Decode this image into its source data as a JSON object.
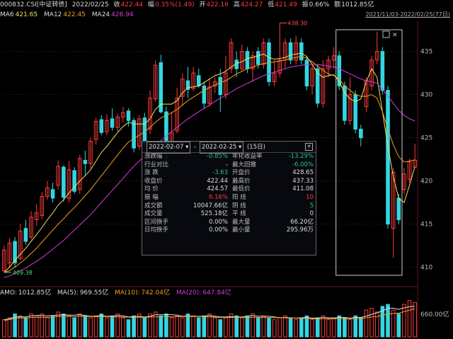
{
  "header": {
    "code": "000832.CSI[中证转债]",
    "date": "2022/02/25",
    "close_label": "收",
    "close": "422.44",
    "change_label": "幅",
    "change": "0.35%(1.49)",
    "open_label": "开",
    "open": "422.16",
    "high_label": "高",
    "high": "424.27",
    "low_label": "低",
    "low": "421.49",
    "amp_label": "振",
    "amp": "0.66%",
    "amount_label": "额",
    "amount": "1012.85亿",
    "ma6": "MA6",
    "ma6_val": "421.65",
    "ma12": "MA12",
    "ma12_val": "422.45",
    "ma24": "MA24",
    "ma24_val": "426.94",
    "range": "2021/11/03-2022/02/25(77日)"
  },
  "colors": {
    "up": "#ff3b3b",
    "down": "#33d6e0",
    "ma6": "#f0e060",
    "ma12": "#f0a020",
    "ma24": "#d03ed8",
    "selection": "#cccccc"
  },
  "annotations": {
    "max_label": "438.30",
    "min_label": "409.38"
  },
  "amo": {
    "label": "AMO:",
    "value": "1012.85亿",
    "ma5": "MA(5):",
    "ma5_val": "969.55亿",
    "ma10": "MA(10):",
    "ma10_val": "742.04亿",
    "ma20": "MA(20):",
    "ma20_val": "647.84亿",
    "axis_label": "660.00亿"
  },
  "info_panel": {
    "start": "2022-02-07",
    "sep": "-",
    "end": "2022-02-25",
    "days": "(15日)",
    "rows": [
      [
        "涨跌幅",
        "-0.85%",
        "年化收益率",
        "-13.29%"
      ],
      [
        "行业对比",
        "-",
        "最大回撤",
        "-6.00%"
      ],
      [
        "涨  跌",
        "-3.63",
        "开盘价",
        "428.65"
      ],
      [
        "收盘价",
        "422.44",
        "最高价",
        "437.33"
      ],
      [
        "均  价",
        "424.57",
        "最低价",
        "411.08"
      ],
      [
        "振  幅",
        "6.16%",
        "阳  线",
        "10"
      ],
      [
        "成交额",
        "10047.66亿",
        "阴  线",
        "5"
      ],
      [
        "成交量",
        "525.18亿",
        "平  线",
        "0"
      ],
      [
        "区间换手",
        "0.00%",
        "最大量",
        "66.20亿"
      ],
      [
        "日均换手",
        "0.00%",
        "最小量",
        "295.96万"
      ]
    ]
  },
  "chart_data": {
    "type": "candlestick",
    "title": "000832.CSI[中证转债]",
    "y_ticks": [
      410,
      415,
      420,
      425,
      430,
      435
    ],
    "ylim": [
      408,
      438.5
    ],
    "candles": [
      {
        "o": 409.6,
        "c": 412.0,
        "h": 412.5,
        "l": 409.4
      },
      {
        "o": 410.5,
        "c": 412.8,
        "h": 413.4,
        "l": 410.0
      },
      {
        "o": 413.0,
        "c": 410.5,
        "h": 413.5,
        "l": 410.0
      },
      {
        "o": 411.0,
        "c": 414.2,
        "h": 415.0,
        "l": 410.8
      },
      {
        "o": 414.5,
        "c": 413.0,
        "h": 415.5,
        "l": 412.6
      },
      {
        "o": 413.5,
        "c": 415.8,
        "h": 416.5,
        "l": 413.2
      },
      {
        "o": 415.5,
        "c": 416.3,
        "h": 417.3,
        "l": 414.8
      },
      {
        "o": 416.0,
        "c": 418.2,
        "h": 418.7,
        "l": 415.6
      },
      {
        "o": 418.2,
        "c": 419.2,
        "h": 420.0,
        "l": 417.8
      },
      {
        "o": 419.0,
        "c": 418.0,
        "h": 419.8,
        "l": 417.5
      },
      {
        "o": 419.5,
        "c": 421.7,
        "h": 422.4,
        "l": 419.0
      },
      {
        "o": 421.6,
        "c": 418.1,
        "h": 421.8,
        "l": 417.6
      },
      {
        "o": 418.0,
        "c": 421.3,
        "h": 422.3,
        "l": 417.5
      },
      {
        "o": 421.2,
        "c": 418.8,
        "h": 421.6,
        "l": 418.5
      },
      {
        "o": 419.0,
        "c": 422.6,
        "h": 423.0,
        "l": 418.5
      },
      {
        "o": 422.4,
        "c": 422.0,
        "h": 423.5,
        "l": 420.6
      },
      {
        "o": 422.0,
        "c": 424.6,
        "h": 425.0,
        "l": 421.5
      },
      {
        "o": 424.8,
        "c": 426.9,
        "h": 427.3,
        "l": 424.2
      },
      {
        "o": 427.1,
        "c": 425.6,
        "h": 427.6,
        "l": 425.3
      },
      {
        "o": 425.7,
        "c": 427.0,
        "h": 427.7,
        "l": 425.3
      },
      {
        "o": 427.2,
        "c": 426.2,
        "h": 428.4,
        "l": 425.8
      },
      {
        "o": 426.2,
        "c": 427.4,
        "h": 427.8,
        "l": 425.7
      },
      {
        "o": 427.4,
        "c": 427.9,
        "h": 428.6,
        "l": 426.8
      },
      {
        "o": 428.1,
        "c": 427.0,
        "h": 428.4,
        "l": 426.3
      },
      {
        "o": 427.0,
        "c": 423.8,
        "h": 427.3,
        "l": 423.3
      },
      {
        "o": 424.0,
        "c": 427.2,
        "h": 427.6,
        "l": 423.6
      },
      {
        "o": 427.3,
        "c": 424.5,
        "h": 427.9,
        "l": 424.0
      },
      {
        "o": 426.0,
        "c": 429.6,
        "h": 430.5,
        "l": 425.4
      },
      {
        "o": 429.5,
        "c": 433.4,
        "h": 434.0,
        "l": 429.2
      },
      {
        "o": 433.7,
        "c": 428.0,
        "h": 434.6,
        "l": 427.8
      },
      {
        "o": 428.0,
        "c": 424.2,
        "h": 428.6,
        "l": 421.5
      },
      {
        "o": 424.0,
        "c": 425.6,
        "h": 428.0,
        "l": 423.6
      },
      {
        "o": 425.8,
        "c": 429.6,
        "h": 430.8,
        "l": 425.5
      },
      {
        "o": 429.8,
        "c": 431.8,
        "h": 432.5,
        "l": 428.7
      },
      {
        "o": 431.6,
        "c": 430.6,
        "h": 433.2,
        "l": 429.6
      },
      {
        "o": 430.7,
        "c": 432.5,
        "h": 433.2,
        "l": 430.4
      },
      {
        "o": 432.2,
        "c": 431.0,
        "h": 433.0,
        "l": 430.8
      },
      {
        "o": 431.0,
        "c": 429.0,
        "h": 431.5,
        "l": 428.4
      },
      {
        "o": 429.0,
        "c": 430.9,
        "h": 431.8,
        "l": 428.6
      },
      {
        "o": 431.0,
        "c": 431.5,
        "h": 432.0,
        "l": 430.2
      },
      {
        "o": 432.0,
        "c": 430.0,
        "h": 433.0,
        "l": 428.0
      },
      {
        "o": 430.0,
        "c": 432.5,
        "h": 434.5,
        "l": 429.5
      },
      {
        "o": 433.0,
        "c": 436.0,
        "h": 436.5,
        "l": 432.5
      },
      {
        "o": 434.0,
        "c": 433.0,
        "h": 435.0,
        "l": 432.0
      },
      {
        "o": 433.0,
        "c": 435.0,
        "h": 435.8,
        "l": 432.8
      },
      {
        "o": 435.0,
        "c": 433.0,
        "h": 435.5,
        "l": 432.5
      },
      {
        "o": 433.0,
        "c": 434.5,
        "h": 435.0,
        "l": 431.5
      },
      {
        "o": 435.0,
        "c": 433.5,
        "h": 435.5,
        "l": 433.0
      },
      {
        "o": 433.5,
        "c": 436.0,
        "h": 436.5,
        "l": 433.0
      },
      {
        "o": 436.0,
        "c": 431.5,
        "h": 436.5,
        "l": 431.0
      },
      {
        "o": 431.5,
        "c": 432.5,
        "h": 434.0,
        "l": 431.0
      },
      {
        "o": 432.5,
        "c": 434.0,
        "h": 438.3,
        "l": 432.0
      },
      {
        "o": 434.0,
        "c": 436.0,
        "h": 436.5,
        "l": 433.0
      },
      {
        "o": 436.0,
        "c": 434.0,
        "h": 436.5,
        "l": 433.5
      },
      {
        "o": 434.0,
        "c": 436.0,
        "h": 436.8,
        "l": 433.5
      },
      {
        "o": 436.0,
        "c": 434.0,
        "h": 436.5,
        "l": 433.5
      },
      {
        "o": 434.0,
        "c": 431.0,
        "h": 434.5,
        "l": 430.5
      },
      {
        "o": 431.0,
        "c": 433.0,
        "h": 433.5,
        "l": 430.0
      },
      {
        "o": 433.0,
        "c": 429.0,
        "h": 433.5,
        "l": 428.5
      },
      {
        "o": 429.0,
        "c": 433.0,
        "h": 434.0,
        "l": 428.5
      },
      {
        "o": 433.0,
        "c": 434.0,
        "h": 434.5,
        "l": 432.0
      },
      {
        "o": 434.0,
        "c": 434.5,
        "h": 435.5,
        "l": 433.0
      },
      {
        "o": 434.5,
        "c": 431.0,
        "h": 435.0,
        "l": 430.5
      },
      {
        "o": 431.0,
        "c": 427.0,
        "h": 431.5,
        "l": 426.5
      },
      {
        "o": 427.0,
        "c": 430.0,
        "h": 432.0,
        "l": 426.5
      },
      {
        "o": 430.0,
        "c": 426.0,
        "h": 430.5,
        "l": 425.5
      },
      {
        "o": 426.0,
        "c": 425.0,
        "h": 426.5,
        "l": 424.0
      },
      {
        "o": 428.6,
        "c": 431.6,
        "h": 432.0,
        "l": 428.0
      },
      {
        "o": 431.0,
        "c": 434.0,
        "h": 434.5,
        "l": 430.5
      },
      {
        "o": 434.0,
        "c": 435.0,
        "h": 437.3,
        "l": 433.5
      },
      {
        "o": 435.0,
        "c": 430.5,
        "h": 435.5,
        "l": 430.0
      },
      {
        "o": 430.5,
        "c": 415.0,
        "h": 431.0,
        "l": 414.5
      },
      {
        "o": 414.5,
        "c": 421.0,
        "h": 421.5,
        "l": 411.1
      },
      {
        "o": 418.0,
        "c": 415.5,
        "h": 418.5,
        "l": 415.0
      },
      {
        "o": 419.0,
        "c": 420.8,
        "h": 421.5,
        "l": 418.5
      },
      {
        "o": 420.2,
        "c": 422.2,
        "h": 422.6,
        "l": 419.8
      },
      {
        "o": 421.6,
        "c": 422.4,
        "h": 424.3,
        "l": 421.5
      }
    ],
    "ma6": [
      409.4,
      410.0,
      410.8,
      411.5,
      412.2,
      413.0,
      413.8,
      414.6,
      415.5,
      416.3,
      417.2,
      417.8,
      418.6,
      419.3,
      420.0,
      420.6,
      421.3,
      422.3,
      423.3,
      424.0,
      424.8,
      425.6,
      426.3,
      426.8,
      426.6,
      426.6,
      426.6,
      427.2,
      428.3,
      428.9,
      428.9,
      428.9,
      429.3,
      430.2,
      430.8,
      430.9,
      431.0,
      431.4,
      431.8,
      432.2,
      432.4,
      432.7,
      433.2,
      433.6,
      433.8,
      434.2,
      434.3,
      434.5,
      434.7,
      434.3,
      434.1,
      434.2,
      434.3,
      434.6,
      434.7,
      434.8,
      434.4,
      433.5,
      432.5,
      432.0,
      432.2,
      432.3,
      431.5,
      430.2,
      429.5,
      429.2,
      429.5,
      431.5,
      433.0,
      432.0,
      428.0,
      424.0,
      420.5,
      418.0,
      417.5,
      419.5,
      421.65
    ],
    "ma12": [
      409.4,
      409.6,
      410.0,
      410.5,
      411.0,
      411.6,
      412.2,
      412.9,
      413.6,
      414.3,
      415.0,
      415.6,
      416.3,
      416.9,
      417.6,
      418.3,
      419.0,
      419.8,
      420.6,
      421.4,
      422.2,
      423.0,
      423.8,
      424.5,
      424.9,
      425.3,
      425.7,
      426.2,
      426.8,
      427.3,
      427.6,
      427.9,
      428.3,
      428.8,
      429.3,
      429.7,
      430.1,
      430.5,
      430.8,
      431.1,
      431.4,
      431.6,
      432.0,
      432.4,
      432.7,
      433.0,
      433.2,
      433.4,
      433.6,
      433.7,
      433.8,
      433.9,
      434.0,
      434.2,
      434.3,
      434.4,
      434.2,
      433.8,
      433.3,
      432.8,
      432.4,
      432.2,
      431.8,
      431.0,
      430.5,
      430.0,
      429.8,
      429.8,
      430.0,
      429.6,
      428.0,
      426.0,
      424.2,
      422.8,
      422.2,
      422.3,
      422.45
    ],
    "ma24": [
      408.8,
      409.0,
      409.3,
      409.6,
      409.9,
      410.3,
      410.7,
      411.1,
      411.6,
      412.1,
      412.6,
      413.1,
      413.7,
      414.3,
      414.9,
      415.5,
      416.1,
      416.8,
      417.5,
      418.2,
      418.9,
      419.6,
      420.3,
      421.0,
      421.7,
      422.3,
      422.9,
      423.5,
      424.1,
      424.7,
      425.2,
      425.7,
      426.2,
      426.7,
      427.2,
      427.6,
      428.0,
      428.4,
      428.8,
      429.2,
      429.6,
      429.9,
      430.3,
      430.7,
      431.0,
      431.3,
      431.6,
      431.9,
      432.2,
      432.4,
      432.6,
      432.8,
      433.0,
      433.2,
      433.3,
      433.4,
      433.5,
      433.5,
      433.5,
      433.4,
      433.3,
      433.2,
      433.0,
      432.7,
      432.4,
      432.1,
      431.8,
      431.6,
      431.5,
      431.3,
      430.6,
      429.8,
      429.0,
      428.2,
      427.6,
      427.2,
      426.94
    ],
    "volume": [
      0.45,
      0.5,
      0.6,
      0.55,
      0.5,
      0.6,
      0.55,
      0.6,
      0.5,
      0.55,
      0.65,
      0.6,
      0.55,
      0.5,
      0.6,
      0.55,
      0.5,
      0.55,
      0.6,
      0.5,
      0.55,
      0.6,
      0.5,
      0.45,
      0.55,
      0.6,
      0.5,
      0.6,
      0.65,
      0.55,
      0.6,
      0.5,
      0.55,
      0.5,
      0.6,
      0.55,
      0.5,
      0.55,
      0.6,
      0.5,
      0.45,
      0.5,
      0.6,
      0.55,
      0.5,
      0.55,
      0.6,
      0.5,
      0.55,
      0.5,
      0.45,
      0.5,
      0.55,
      0.5,
      0.45,
      0.5,
      0.55,
      0.45,
      0.5,
      0.55,
      0.45,
      0.5,
      0.55,
      0.5,
      0.45,
      0.55,
      0.5,
      0.7,
      0.75,
      0.65,
      0.8,
      0.85,
      0.7,
      0.6,
      0.85,
      0.95,
      0.9
    ]
  }
}
